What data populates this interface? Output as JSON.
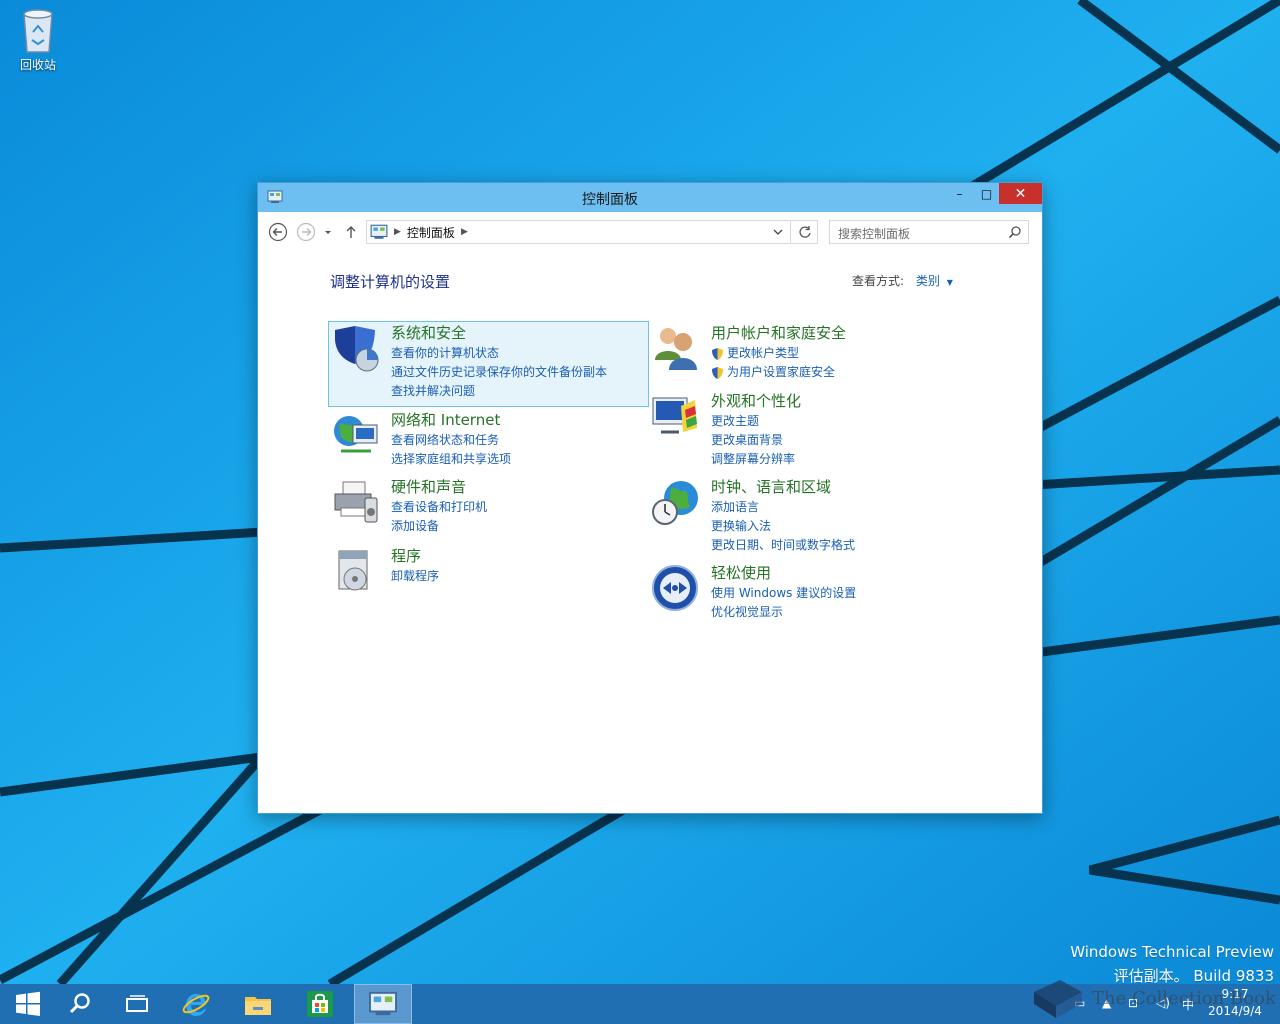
{
  "desktop": {
    "recycle_bin_label": "回收站",
    "watermark_line1": "Windows Technical Preview",
    "watermark_line2": "评估副本。 Build 9833"
  },
  "window": {
    "title": "控制面板",
    "buttons": {
      "minimize": "–",
      "maximize": "□",
      "close": "✕"
    },
    "address": {
      "crumb": "控制面板"
    },
    "search": {
      "placeholder": "搜索控制面板"
    },
    "heading": "调整计算机的设置",
    "view_by": {
      "label": "查看方式:",
      "value": "类别"
    },
    "categories_left": [
      {
        "title": "系统和安全",
        "icon": "shield-icon",
        "links": [
          "查看你的计算机状态",
          "通过文件历史记录保存你的文件备份副本",
          "查找并解决问题"
        ]
      },
      {
        "title": "网络和 Internet",
        "icon": "network-icon",
        "links": [
          "查看网络状态和任务",
          "选择家庭组和共享选项"
        ]
      },
      {
        "title": "硬件和声音",
        "icon": "printer-icon",
        "links": [
          "查看设备和打印机",
          "添加设备"
        ]
      },
      {
        "title": "程序",
        "icon": "programs-icon",
        "links": [
          "卸载程序"
        ]
      }
    ],
    "categories_right": [
      {
        "title": "用户帐户和家庭安全",
        "icon": "users-icon",
        "links": [
          "更改帐户类型",
          "为用户设置家庭安全"
        ]
      },
      {
        "title": "外观和个性化",
        "icon": "appearance-icon",
        "links": [
          "更改主题",
          "更改桌面背景",
          "调整屏幕分辨率"
        ]
      },
      {
        "title": "时钟、语言和区域",
        "icon": "clock-globe-icon",
        "links": [
          "添加语言",
          "更换输入法",
          "更改日期、时间或数字格式"
        ]
      },
      {
        "title": "轻松使用",
        "icon": "ease-of-access-icon",
        "links": [
          "使用 Windows 建议的设置",
          "优化视觉显示"
        ]
      }
    ]
  },
  "taskbar": {
    "items": [
      "start-button",
      "search-icon",
      "task-view-icon",
      "internet-explorer-icon",
      "file-explorer-icon",
      "store-icon",
      "control-panel-icon"
    ],
    "tray_ime": "中",
    "clock_time": "9:17",
    "clock_date": "2014/9/4"
  },
  "brand": {
    "text": "The Collection Book"
  }
}
